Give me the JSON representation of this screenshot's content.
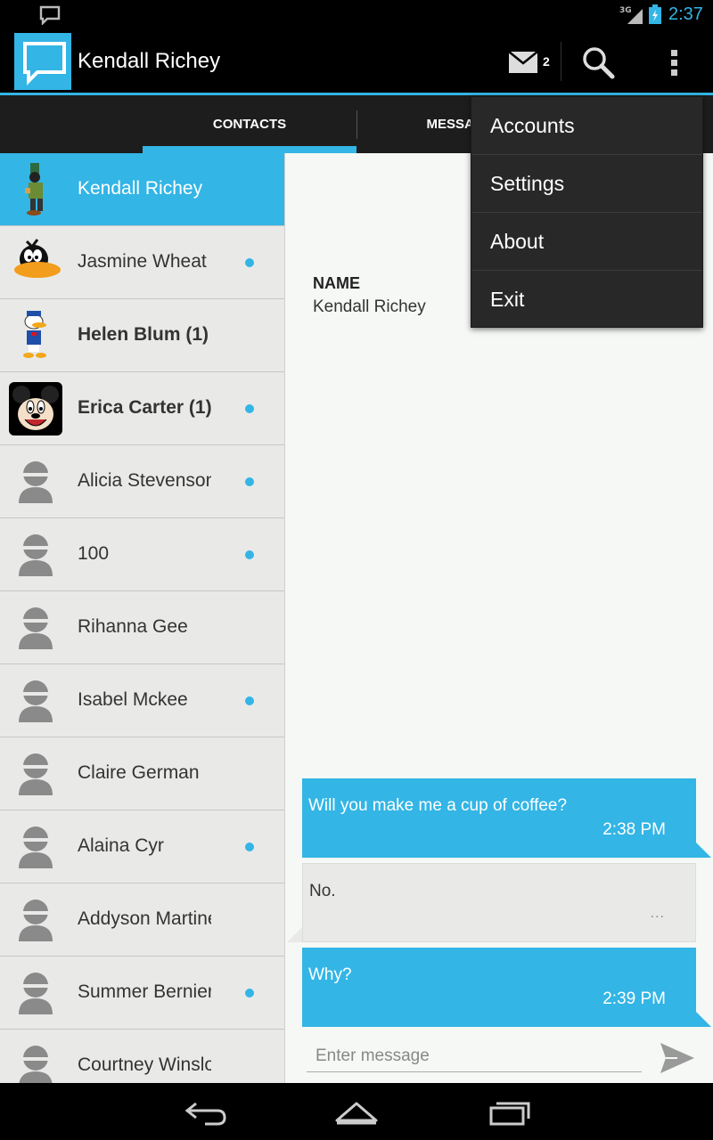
{
  "status_bar": {
    "network": "3G",
    "time": "2:37",
    "icons": [
      "notification-icon",
      "signal-icon",
      "battery-charging-icon"
    ]
  },
  "action_bar": {
    "title": "Kendall Richey",
    "icons": [
      "app-chat-icon",
      "mail-icon",
      "search-icon",
      "overflow-icon"
    ],
    "mail_count": "2"
  },
  "tabs": [
    {
      "label": "CONTACTS",
      "selected": true
    },
    {
      "label": "MESSAGES",
      "selected": false
    }
  ],
  "contacts": [
    {
      "name": "Kendall Richey",
      "bold": false,
      "dot": false,
      "avatar": "goofy-avatar"
    },
    {
      "name": "Jasmine Wheat",
      "bold": false,
      "dot": true,
      "avatar": "daffy-avatar"
    },
    {
      "name": "Helen Blum (1)",
      "bold": true,
      "dot": false,
      "avatar": "donald-avatar"
    },
    {
      "name": "Erica Carter (1)",
      "bold": true,
      "dot": true,
      "avatar": "mickey-avatar"
    },
    {
      "name": "Alicia Stevenson",
      "bold": false,
      "dot": true,
      "avatar": "default-avatar"
    },
    {
      "name": "100",
      "bold": false,
      "dot": true,
      "avatar": "default-avatar"
    },
    {
      "name": "Rihanna Gee",
      "bold": false,
      "dot": false,
      "avatar": "default-avatar"
    },
    {
      "name": "Isabel Mckee",
      "bold": false,
      "dot": true,
      "avatar": "default-avatar"
    },
    {
      "name": "Claire German",
      "bold": false,
      "dot": false,
      "avatar": "default-avatar"
    },
    {
      "name": "Alaina Cyr",
      "bold": false,
      "dot": true,
      "avatar": "default-avatar"
    },
    {
      "name": "Addyson Martinez",
      "bold": false,
      "dot": false,
      "avatar": "default-avatar"
    },
    {
      "name": "Summer Bernier",
      "bold": false,
      "dot": true,
      "avatar": "default-avatar"
    },
    {
      "name": "Courtney Winslow",
      "bold": false,
      "dot": false,
      "avatar": "default-avatar"
    }
  ],
  "contact_info": {
    "label": "NAME",
    "value": "Kendall Richey"
  },
  "messages": [
    {
      "direction": "out",
      "text": "Will you make me a cup of coffee?",
      "time": "2:38 PM"
    },
    {
      "direction": "in",
      "text": "No.",
      "status": "..."
    },
    {
      "direction": "out",
      "text": "Why?",
      "time": "2:39 PM"
    }
  ],
  "compose": {
    "placeholder": "Enter message"
  },
  "overflow_menu": {
    "items": [
      "Accounts",
      "Settings",
      "About",
      "Exit"
    ]
  },
  "colors": {
    "accent": "#33b5e5",
    "list_bg": "#e9eae8",
    "conversation_bg": "#f5f8f5",
    "menu_bg": "#282828"
  }
}
